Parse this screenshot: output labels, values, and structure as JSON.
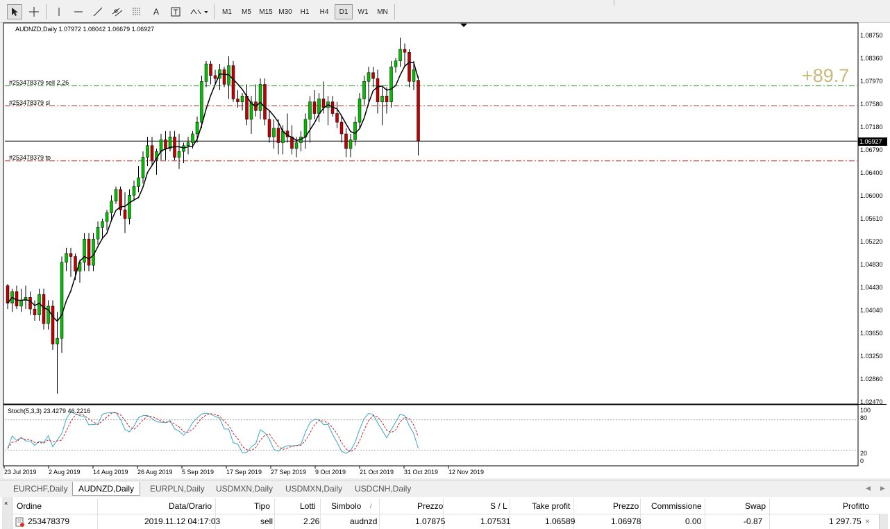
{
  "toolbar": {
    "draw_tools": [
      "cursor-icon",
      "crosshair-icon",
      "vertical-line-icon",
      "horizontal-line-icon",
      "trendline-icon",
      "equidistant-channel-icon",
      "fibonacci-icon",
      "text-icon",
      "text-label-icon",
      "arrows-icon"
    ],
    "text_tool_label": "A",
    "timeframes": [
      "M1",
      "M5",
      "M15",
      "M30",
      "H1",
      "H4",
      "D1",
      "W1",
      "MN"
    ],
    "active_timeframe": "D1"
  },
  "chart": {
    "title": "AUDNZD,Daily  1.07972 1.08042 1.06679 1.06927",
    "order_sell_label": "#253478379 sell 2.26",
    "order_sl_label": "#253478379 sl",
    "order_tp_label": "#253478379 tp",
    "profit_label": "+89.7",
    "current_price": "1.06927",
    "y_ticks": [
      "1.08750",
      "1.08360",
      "1.07970",
      "1.07580",
      "1.07180",
      "1.06790",
      "1.06400",
      "1.06000",
      "1.05610",
      "1.05220",
      "1.04830",
      "1.04430",
      "1.04040",
      "1.03650",
      "1.03250",
      "1.02860",
      "1.02470"
    ],
    "x_ticks": [
      "23 Jul 2019",
      "2 Aug 2019",
      "14 Aug 2019",
      "26 Aug 2019",
      "5 Sep 2019",
      "17 Sep 2019",
      "27 Sep 2019",
      "9 Oct 2019",
      "21 Oct 2019",
      "31 Oct 2019",
      "12 Nov 2019"
    ],
    "stoch_label": "Stoch(5,3,3) 23.4279 46.2216",
    "stoch_ticks": [
      "100",
      "80",
      "20",
      "0"
    ]
  },
  "chart_data": {
    "type": "candlestick",
    "symbol": "AUDNZD",
    "timeframe": "Daily",
    "ylim": [
      1.0247,
      1.0875
    ],
    "price_lines": {
      "sell": 1.07875,
      "sl": 1.07531,
      "tp": 1.06589,
      "current": 1.06927
    },
    "candles": [
      [
        1.0445,
        1.0448,
        1.0405,
        1.0415
      ],
      [
        1.0415,
        1.044,
        1.04,
        1.0435
      ],
      [
        1.0435,
        1.0445,
        1.0405,
        1.041
      ],
      [
        1.041,
        1.044,
        1.04,
        1.042
      ],
      [
        1.042,
        1.0445,
        1.0405,
        1.0425
      ],
      [
        1.0425,
        1.0435,
        1.0395,
        1.0405
      ],
      [
        1.0405,
        1.042,
        1.0385,
        1.0395
      ],
      [
        1.0395,
        1.044,
        1.0385,
        1.043
      ],
      [
        1.043,
        1.044,
        1.037,
        1.038
      ],
      [
        1.038,
        1.042,
        1.037,
        1.041
      ],
      [
        1.041,
        1.042,
        1.0335,
        1.0345
      ],
      [
        1.0345,
        1.04,
        1.026,
        1.0355
      ],
      [
        1.0355,
        1.0495,
        1.033,
        1.0485
      ],
      [
        1.0485,
        1.051,
        1.047,
        1.05
      ],
      [
        1.05,
        1.051,
        1.046,
        1.0495
      ],
      [
        1.0495,
        1.05,
        1.0455,
        1.047
      ],
      [
        1.047,
        1.049,
        1.045,
        1.0485
      ],
      [
        1.0485,
        1.0535,
        1.047,
        1.0525
      ],
      [
        1.0525,
        1.0535,
        1.047,
        1.048
      ],
      [
        1.048,
        1.0535,
        1.047,
        1.0525
      ],
      [
        1.0525,
        1.0555,
        1.0515,
        1.0545
      ],
      [
        1.0545,
        1.056,
        1.0525,
        1.0555
      ],
      [
        1.0555,
        1.0575,
        1.054,
        1.057
      ],
      [
        1.057,
        1.06,
        1.0555,
        1.059
      ],
      [
        1.059,
        1.0615,
        1.0585,
        1.061
      ],
      [
        1.061,
        1.0615,
        1.0565,
        1.0575
      ],
      [
        1.0575,
        1.0605,
        1.0535,
        1.056
      ],
      [
        1.056,
        1.061,
        1.055,
        1.06
      ],
      [
        1.06,
        1.0625,
        1.059,
        1.0615
      ],
      [
        1.0615,
        1.065,
        1.0605,
        1.063
      ],
      [
        1.063,
        1.0675,
        1.062,
        1.0665
      ],
      [
        1.0665,
        1.07,
        1.065,
        1.0685
      ],
      [
        1.0685,
        1.07,
        1.065,
        1.066
      ],
      [
        1.066,
        1.068,
        1.0635,
        1.0675
      ],
      [
        1.0675,
        1.0705,
        1.066,
        1.0695
      ],
      [
        1.0695,
        1.071,
        1.066,
        1.068
      ],
      [
        1.068,
        1.071,
        1.0675,
        1.07
      ],
      [
        1.07,
        1.071,
        1.066,
        1.0665
      ],
      [
        1.0665,
        1.0705,
        1.0645,
        1.0675
      ],
      [
        1.0675,
        1.069,
        1.0655,
        1.0685
      ],
      [
        1.0685,
        1.07,
        1.067,
        1.069
      ],
      [
        1.069,
        1.071,
        1.068,
        1.0705
      ],
      [
        1.0705,
        1.0735,
        1.069,
        1.0725
      ],
      [
        1.0725,
        1.0805,
        1.0715,
        1.0795
      ],
      [
        1.0795,
        1.083,
        1.0785,
        1.0825
      ],
      [
        1.0825,
        1.083,
        1.079,
        1.0805
      ],
      [
        1.0805,
        1.0815,
        1.079,
        1.08
      ],
      [
        1.08,
        1.0825,
        1.078,
        1.0815
      ],
      [
        1.0815,
        1.082,
        1.0785,
        1.079
      ],
      [
        1.079,
        1.0838,
        1.0765,
        1.0822
      ],
      [
        1.0822,
        1.083,
        1.076,
        1.0765
      ],
      [
        1.0765,
        1.078,
        1.075,
        1.076
      ],
      [
        1.076,
        1.0775,
        1.0745,
        1.077
      ],
      [
        1.077,
        1.079,
        1.072,
        1.073
      ],
      [
        1.073,
        1.077,
        1.0705,
        1.076
      ],
      [
        1.076,
        1.079,
        1.0735,
        1.0745
      ],
      [
        1.0745,
        1.08,
        1.073,
        1.079
      ],
      [
        1.079,
        1.08,
        1.072,
        1.073
      ],
      [
        1.073,
        1.0745,
        1.069,
        1.07
      ],
      [
        1.07,
        1.073,
        1.068,
        1.0715
      ],
      [
        1.0715,
        1.073,
        1.067,
        1.069
      ],
      [
        1.069,
        1.072,
        1.067,
        1.071
      ],
      [
        1.071,
        1.074,
        1.069,
        1.07
      ],
      [
        1.07,
        1.072,
        1.067,
        1.068
      ],
      [
        1.068,
        1.07,
        1.0665,
        1.069
      ],
      [
        1.069,
        1.071,
        1.0675,
        1.07
      ],
      [
        1.07,
        1.074,
        1.068,
        1.073
      ],
      [
        1.073,
        1.077,
        1.069,
        1.076
      ],
      [
        1.076,
        1.078,
        1.073,
        1.074
      ],
      [
        1.074,
        1.0775,
        1.0725,
        1.0765
      ],
      [
        1.0765,
        1.0795,
        1.074,
        1.075
      ],
      [
        1.075,
        1.077,
        1.072,
        1.076
      ],
      [
        1.076,
        1.077,
        1.0735,
        1.074
      ],
      [
        1.074,
        1.076,
        1.0715,
        1.0725
      ],
      [
        1.0725,
        1.0735,
        1.069,
        1.0705
      ],
      [
        1.0705,
        1.0715,
        1.0665,
        1.068
      ],
      [
        1.068,
        1.0705,
        1.0665,
        1.0695
      ],
      [
        1.0695,
        1.0735,
        1.0685,
        1.0725
      ],
      [
        1.0725,
        1.0775,
        1.0715,
        1.0765
      ],
      [
        1.0765,
        1.0805,
        1.0755,
        1.0795
      ],
      [
        1.0795,
        1.082,
        1.076,
        1.081
      ],
      [
        1.081,
        1.082,
        1.0785,
        1.08
      ],
      [
        1.08,
        1.0815,
        1.074,
        1.076
      ],
      [
        1.076,
        1.0785,
        1.072,
        1.077
      ],
      [
        1.077,
        1.0785,
        1.074,
        1.076
      ],
      [
        1.076,
        1.083,
        1.075,
        1.082
      ],
      [
        1.082,
        1.0835,
        1.081,
        1.083
      ],
      [
        1.083,
        1.087,
        1.082,
        1.085
      ],
      [
        1.085,
        1.086,
        1.082,
        1.0845
      ],
      [
        1.0845,
        1.085,
        1.0785,
        1.0795
      ],
      [
        1.0795,
        1.083,
        1.078,
        1.0815
      ],
      [
        1.0797,
        1.0804,
        1.0668,
        1.0693
      ]
    ],
    "ma_value_at_end": 1.079,
    "stochastic": {
      "name": "Stoch(5,3,3)",
      "main": 23.4279,
      "signal": 46.2216,
      "levels": [
        80,
        20
      ],
      "ylim": [
        0,
        100
      ]
    }
  },
  "symbol_tabs": [
    "EURCHF,Daily",
    "AUDNZD,Daily",
    "EURPLN,Daily",
    "USDMXN,Daily",
    "USDMXN,Daily",
    "USDCNH,Daily"
  ],
  "active_tab": "AUDNZD,Daily",
  "trade_table": {
    "headers": [
      "Ordine",
      "Data/Orario",
      "Tipo",
      "Lotti",
      "Simbolo",
      "/",
      "Prezzo",
      "S / L",
      "Take profit",
      "Prezzo",
      "Commissione",
      "Swap",
      "Profitto"
    ],
    "rows": [
      {
        "ordine": "253478379",
        "data": "2019.11.12 04:17:03",
        "tipo": "sell",
        "lotti": "2.26",
        "simbolo": "audnzd",
        "prezzo": "1.07875",
        "sl": "1.07531",
        "tp": "1.06589",
        "prezzo_corr": "1.06978",
        "commissione": "0.00",
        "swap": "-0.87",
        "profitto": "1 297.75"
      }
    ],
    "close_glyph": "×"
  },
  "colors": {
    "bull": "#00c000",
    "bear": "#c00000",
    "ma": "#000000",
    "sell_line": "#32a832",
    "sl_line": "#c02020",
    "tp_line": "#c02020",
    "profit_text": "#c8b87a",
    "stoch_main": "#3aa6c9",
    "stoch_signal": "#d02020"
  }
}
